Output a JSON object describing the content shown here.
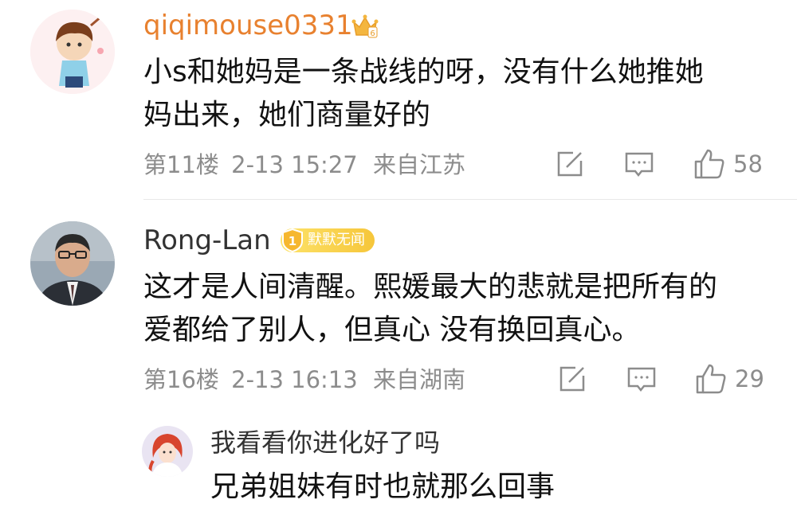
{
  "comments": [
    {
      "username": "qiqimouse0331",
      "username_color": "#e8812f",
      "badge_icon": "crown-icon",
      "content_lines": [
        "小s和她妈是一条战线的呀，没有什么她推她",
        "妈出来，她们商量好的"
      ],
      "floor": "第11楼",
      "time": "2-13 15:27",
      "location": "来自江苏",
      "likes": "58"
    },
    {
      "username": "Rong-Lan",
      "username_color": "#333333",
      "badge_text": "默默无闻",
      "badge_color": "#f7c843",
      "content_lines": [
        "这才是人间清醒。熙媛最大的悲就是把所有的",
        "爱都给了别人，但真心 没有换回真心。"
      ],
      "floor": "第16楼",
      "time": "2-13 16:13",
      "location": "来自湖南",
      "likes": "29"
    }
  ],
  "reply": {
    "username": "我看看你进化好了吗",
    "username_color": "#333333",
    "content": "兄弟姐妹有时也就那么回事"
  },
  "icons": [
    "edit-icon",
    "comment-icon",
    "thumbs-up-icon"
  ]
}
